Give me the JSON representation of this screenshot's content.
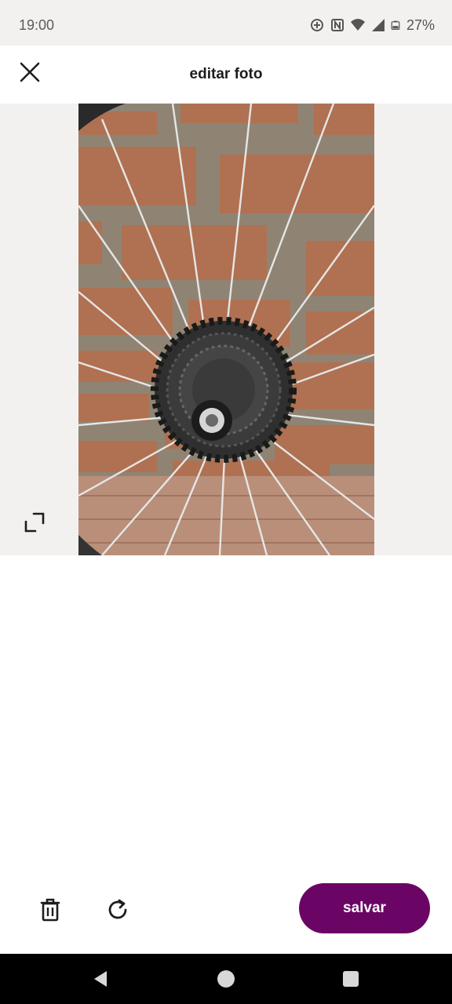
{
  "status_bar": {
    "time": "19:00",
    "battery": "27%",
    "icons": [
      "data-saver-icon",
      "nfc-icon",
      "wifi-icon",
      "signal-icon",
      "battery-icon"
    ]
  },
  "header": {
    "title": "editar foto",
    "close_icon": "close-icon"
  },
  "photo": {
    "description_icon": "photo-image",
    "expand_icon": "expand-icon"
  },
  "toolbar": {
    "delete_icon": "trash-icon",
    "rotate_icon": "rotate-icon",
    "save_label": "salvar"
  },
  "colors": {
    "accent": "#6b0565",
    "status_bg": "#f3f1ef",
    "nav_bg": "#000000"
  },
  "nav": {
    "icons": [
      "back-icon",
      "home-icon",
      "recents-icon"
    ]
  }
}
